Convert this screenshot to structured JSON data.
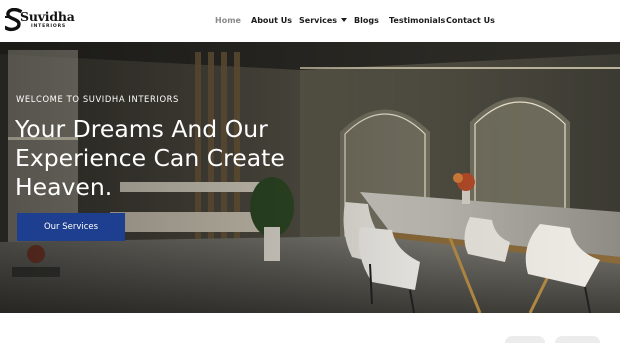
{
  "brand": {
    "name": "Suvidha",
    "tagline": "INTERIORS",
    "logo_icon": "s-monogram-icon"
  },
  "nav": {
    "items": [
      {
        "label": "Home",
        "active": true
      },
      {
        "label": "About Us",
        "active": false
      },
      {
        "label": "Services",
        "active": false,
        "has_dropdown": true
      },
      {
        "label": "Blogs",
        "active": false
      },
      {
        "label": "Testimonials",
        "active": false
      },
      {
        "label": "Contact Us",
        "active": false
      }
    ]
  },
  "hero": {
    "eyebrow": "WELCOME TO SUVIDHA INTERIORS",
    "headline": "Your Dreams And Our Experience Can Create Heaven.",
    "cta_label": "Our Services",
    "image_subject": "dining room interior with marble table and white chairs"
  },
  "colors": {
    "accent": "#1e3f8f",
    "nav_active": "#8a8a8a",
    "nav_text": "#1b1b1b"
  }
}
